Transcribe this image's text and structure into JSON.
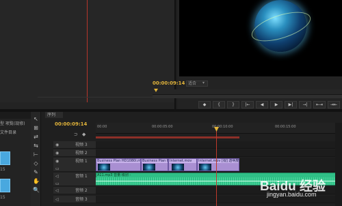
{
  "program_monitor": {
    "timecode": "00:00:09:14",
    "fit_label": "适合",
    "transport_buttons": [
      "◆",
      "{",
      "}",
      "|←",
      "◀",
      "▶",
      "▶|",
      "→|",
      "⇤⇥",
      "⇥⇤"
    ]
  },
  "project_panel": {
    "row1": "型  项覧(现修)",
    "row2": "文件目录",
    "item1_number": "15",
    "item2_number": "15"
  },
  "tools": [
    "↖",
    "⊞",
    "⇄",
    "⇆",
    "⊢",
    "◇",
    "✎",
    "✋",
    "🔍"
  ],
  "timeline": {
    "tab_label": "序列",
    "timecode": "00:00:09:14",
    "ruler_ticks": [
      "00:00",
      "00:00:05:00",
      "00:00:10:00",
      "00:00:15:00"
    ],
    "tracks": [
      {
        "name": "视频 3"
      },
      {
        "name": "视频 2"
      },
      {
        "name": "视频 1"
      },
      {
        "name": "音频 1"
      },
      {
        "name": "音频 2"
      },
      {
        "name": "音频 3"
      }
    ],
    "clips": [
      {
        "label": "Business Plan HD1080i.mov [视]"
      },
      {
        "label": "Business Plan HD"
      },
      {
        "label": "Internet.mov"
      },
      {
        "label": "Internet.mov [视] 透明度:"
      }
    ],
    "audio_clip_label": "A11.mp3 音量:级别 -"
  },
  "watermark": {
    "brand": "Baidu 经验",
    "url": "jingyan.baidu.com"
  }
}
